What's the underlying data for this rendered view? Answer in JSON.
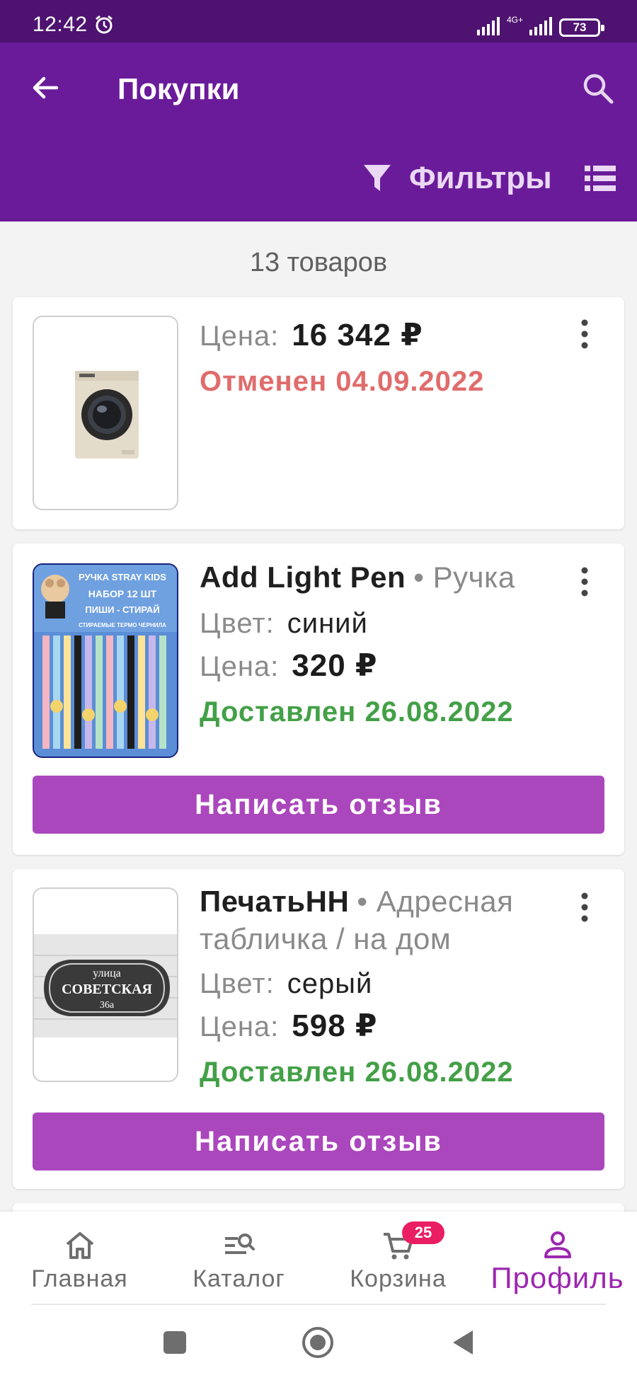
{
  "status_bar": {
    "time": "12:42",
    "network": "4G+",
    "battery": "73"
  },
  "app_bar": {
    "title": "Покупки",
    "filters_label": "Фильтры"
  },
  "items_count": "13 товаров",
  "orders": [
    {
      "price_label": "Цена:",
      "price": "16 342 ₽",
      "status": "Отменен 04.09.2022",
      "status_type": "cancelled",
      "thumbnail": "washing-machine"
    },
    {
      "brand": "Add Light Pen",
      "category": "• Ручка",
      "color_label": "Цвет:",
      "color": "синий",
      "price_label": "Цена:",
      "price": "320 ₽",
      "status": "Доставлен 26.08.2022",
      "status_type": "delivered",
      "review_button": "Написать отзыв",
      "thumbnail": "pen-set",
      "image_text": {
        "line1": "РУЧКА STRAY KIDS",
        "line2": "НАБОР 12 ШТ",
        "line3": "ПИШИ - СТИРАЙ",
        "line4": "СТИРАЕМЫЕ ТЕРМО ЧЕРНИЛА"
      }
    },
    {
      "brand": "ПечатьНН",
      "category_line1": "• Адресная",
      "category_line2": "табличка  / на дом",
      "color_label": "Цвет:",
      "color": "серый",
      "price_label": "Цена:",
      "price": "598 ₽",
      "status": "Доставлен 26.08.2022",
      "status_type": "delivered",
      "review_button": "Написать отзыв",
      "thumbnail": "address-plate",
      "image_text": {
        "top": "улица",
        "middle": "СОВЕТСКАЯ",
        "bottom": "36а"
      }
    }
  ],
  "bottom_nav": [
    {
      "label": "Главная",
      "icon": "home-icon"
    },
    {
      "label": "Каталог",
      "icon": "catalog-search-icon"
    },
    {
      "label": "Корзина",
      "icon": "cart-icon",
      "badge": "25"
    },
    {
      "label": "Профиль",
      "icon": "profile-icon",
      "active": true
    }
  ],
  "colors": {
    "status_bar": "#4e1370",
    "app_bar": "#6a1b9a",
    "accent_button": "#ab47bc",
    "cancelled": "#e06c6c",
    "delivered": "#43a047",
    "active_nav": "#9c27b0",
    "badge": "#e91e63"
  }
}
